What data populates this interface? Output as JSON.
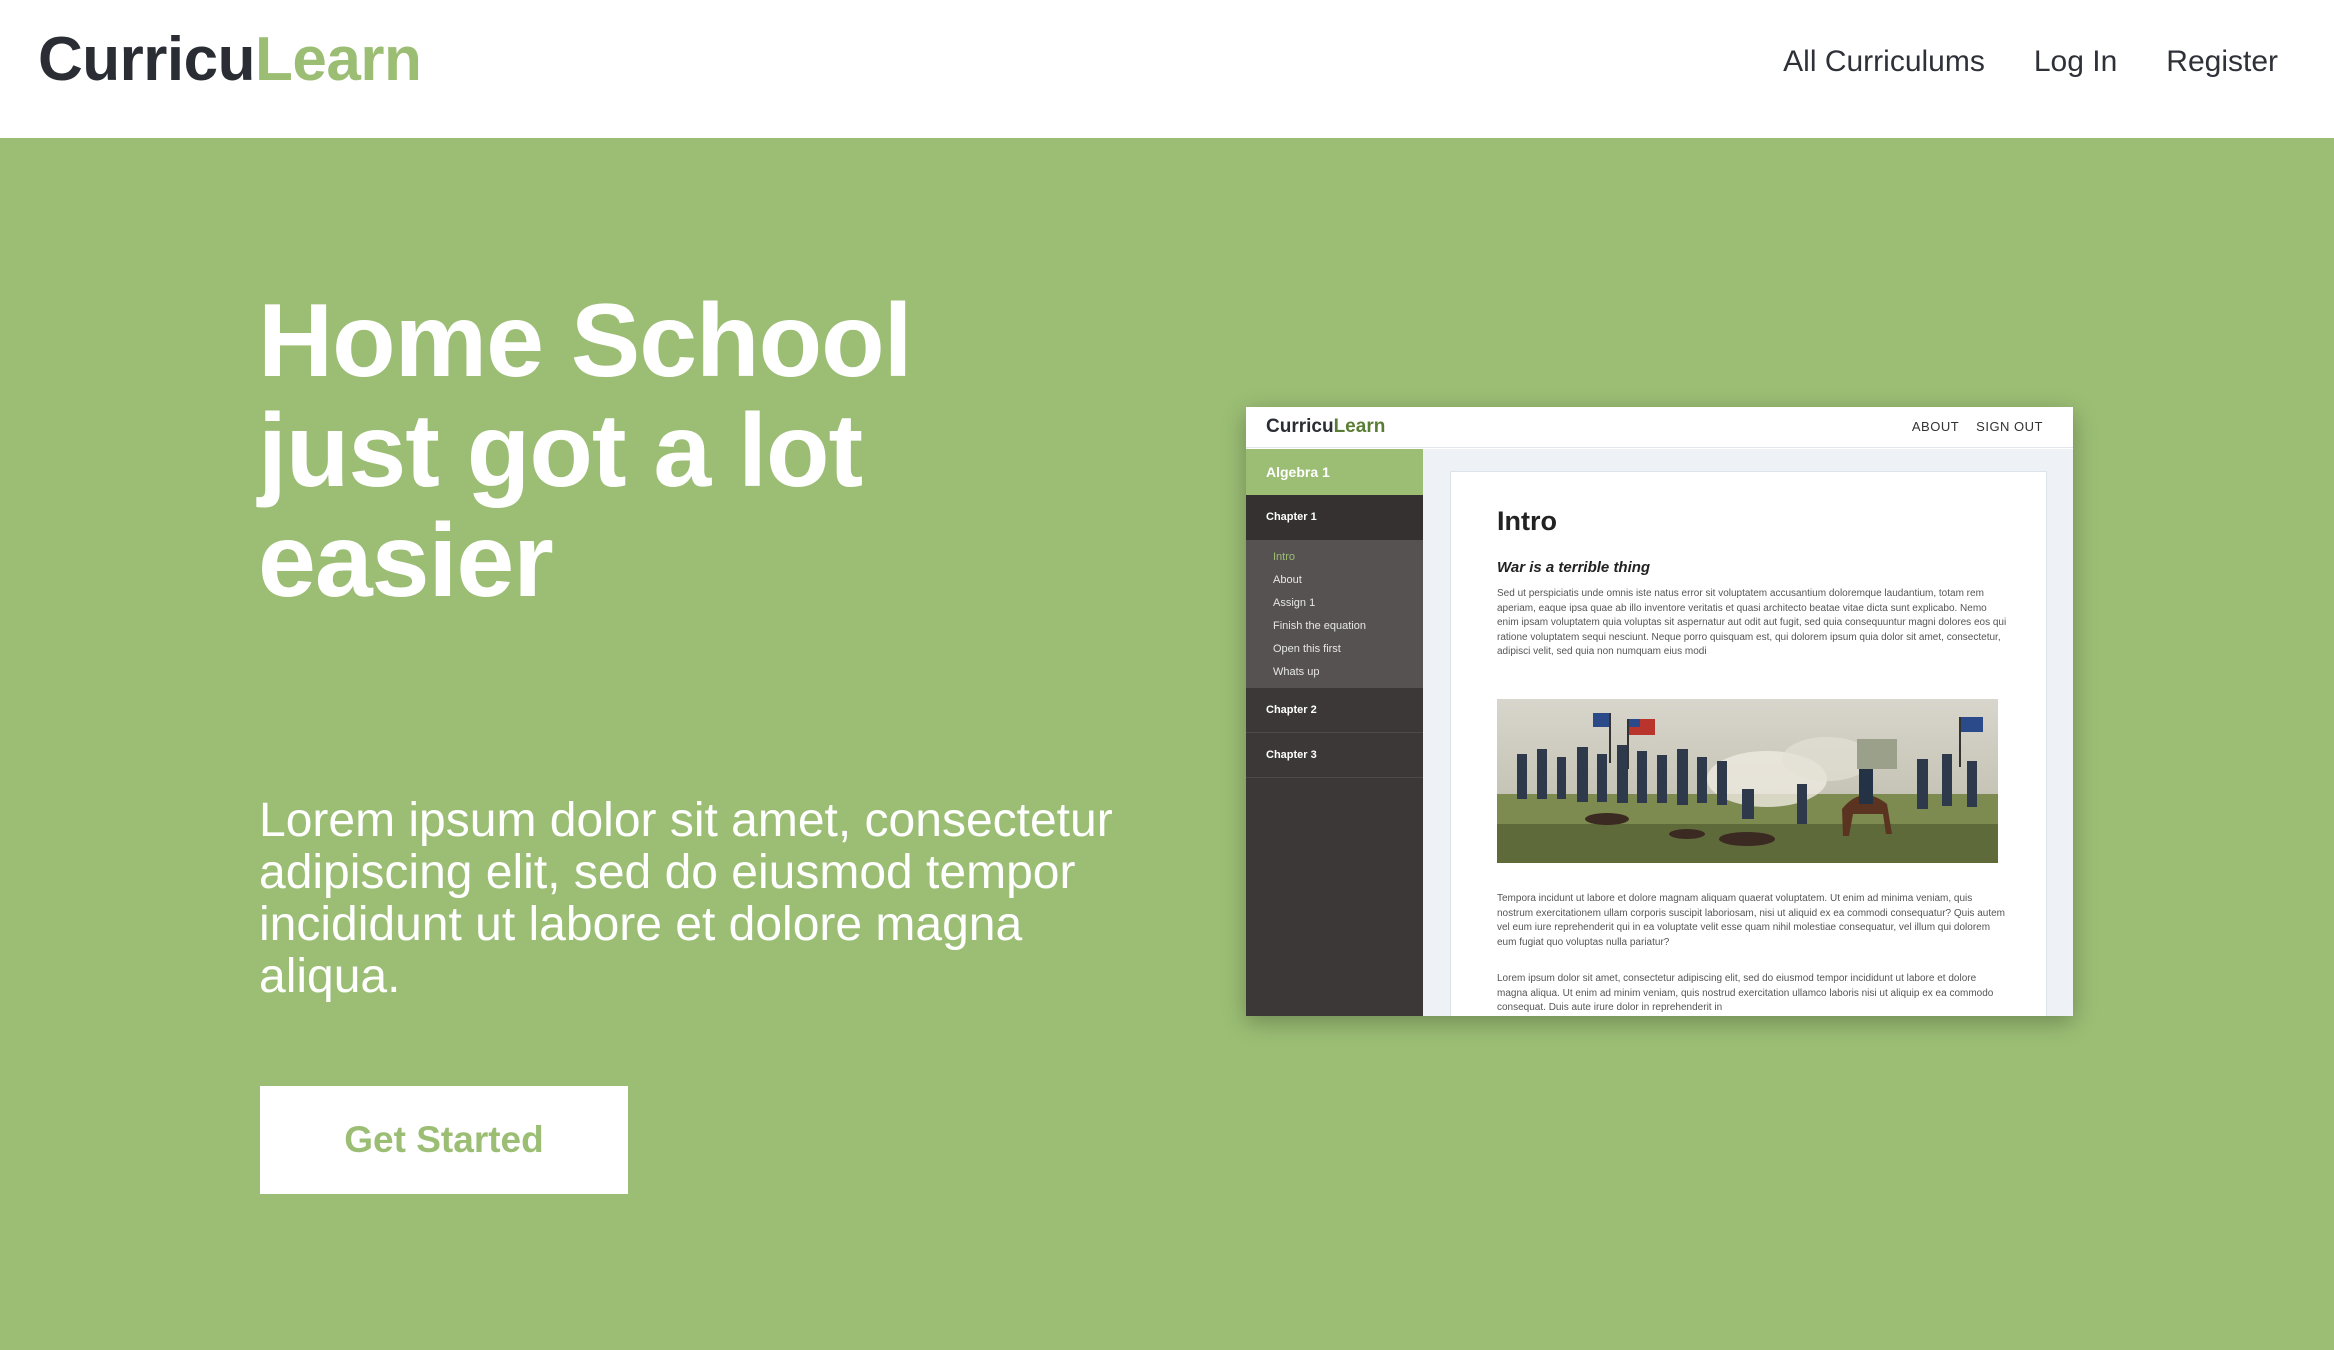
{
  "brand": {
    "part1": "Curricu",
    "part2": "Learn"
  },
  "nav": {
    "items": [
      "All Curriculums",
      "Log In",
      "Register"
    ]
  },
  "hero": {
    "headline_lines": [
      "Home School",
      "just got a lot",
      "easier"
    ],
    "subtext": "Lorem ipsum dolor sit amet, consectetur adipiscing elit, sed do eiusmod tempor incididunt ut labore et dolore magna aliqua.",
    "cta_label": "Get Started"
  },
  "mockup": {
    "brand": {
      "part1": "Curricu",
      "part2": "Learn"
    },
    "nav": [
      "ABOUT",
      "SIGN OUT"
    ],
    "course": "Algebra 1",
    "chapters": [
      "Chapter 1",
      "Chapter 2",
      "Chapter 3"
    ],
    "lessons": [
      "Intro",
      "About",
      "Assign 1",
      "Finish the equation",
      "Open this first",
      "Whats up"
    ],
    "current_lesson": "Intro",
    "content": {
      "title": "Intro",
      "subtitle": "War is a terrible thing",
      "paragraph1": "Sed ut perspiciatis unde omnis iste natus error sit voluptatem accusantium doloremque laudantium, totam rem aperiam, eaque ipsa quae ab illo inventore veritatis et quasi architecto beatae vitae dicta sunt explicabo. Nemo enim ipsam voluptatem quia voluptas sit aspernatur aut odit aut fugit, sed quia consequuntur magni dolores eos qui ratione voluptatem sequi nesciunt. Neque porro quisquam est, qui dolorem ipsum quia dolor sit amet, consectetur, adipisci velit, sed quia non numquam eius modi",
      "paragraph2": "Tempora incidunt ut labore et dolore magnam aliquam quaerat voluptatem. Ut enim ad minima veniam, quis nostrum exercitationem ullam corporis suscipit laboriosam, nisi ut aliquid ex ea commodi consequatur? Quis autem vel eum iure reprehenderit qui in ea voluptate velit esse quam nihil molestiae consequatur, vel illum qui dolorem eum fugiat quo voluptas nulla pariatur?",
      "paragraph3": "Lorem ipsum dolor sit amet, consectetur adipiscing elit, sed do eiusmod tempor incididunt ut labore et dolore magna aliqua. Ut enim ad minim veniam, quis nostrud exercitation ullamco laboris nisi ut aliquip ex ea commodo consequat. Duis aute irure dolor in reprehenderit in"
    }
  },
  "colors": {
    "accent": "#9bbe74",
    "dark": "#2a2d34",
    "sidebar": "#3d3838"
  }
}
